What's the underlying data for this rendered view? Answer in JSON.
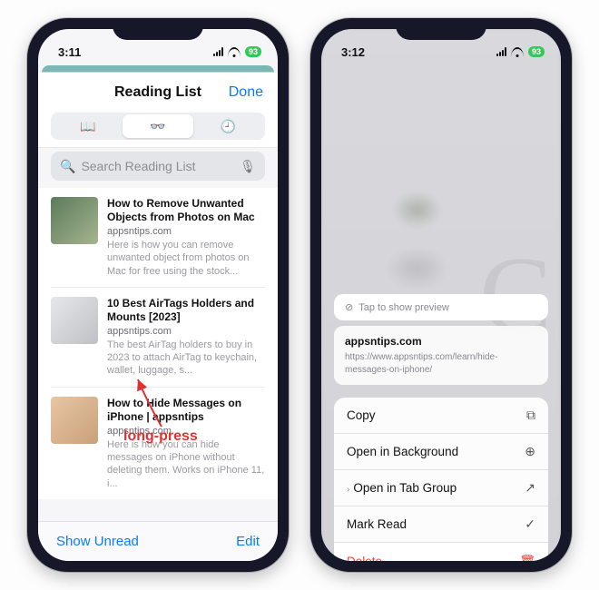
{
  "status": {
    "time_left": "3:11",
    "time_right": "3:12",
    "battery": "93"
  },
  "header": {
    "title": "Reading List",
    "done": "Done"
  },
  "segs": {
    "book": "open-book-icon",
    "glasses": "reading-glasses-icon",
    "clock": "clock-icon"
  },
  "search": {
    "placeholder": "Search Reading List"
  },
  "items": [
    {
      "title": "How to Remove Unwanted Objects from Photos on Mac",
      "domain": "appsntips.com",
      "summary": "Here is how you can remove unwanted object from photos on Mac for free using the stock..."
    },
    {
      "title": "10 Best AirTags Holders and Mounts [2023]",
      "domain": "appsntips.com",
      "summary": "The best AirTag holders to buy in 2023 to attach AirTag to keychain, wallet, luggage, s..."
    },
    {
      "title": "How to Hide Messages on iPhone | appsntips",
      "domain": "appsntips.com",
      "summary": "Here is how you can hide messages on iPhone without deleting them. Works on iPhone 11, i..."
    }
  ],
  "footer": {
    "unread": "Show Unread",
    "edit": "Edit"
  },
  "annotation": "long-press",
  "popover": {
    "tap_preview": "Tap to show preview",
    "domain": "appsntips.com",
    "url": "https://www.appsntips.com/learn/hide-messages-on-iphone/"
  },
  "menu": {
    "copy": "Copy",
    "open_bg": "Open in Background",
    "open_tab": "Open in Tab Group",
    "mark_read": "Mark Read",
    "delete": "Delete"
  }
}
